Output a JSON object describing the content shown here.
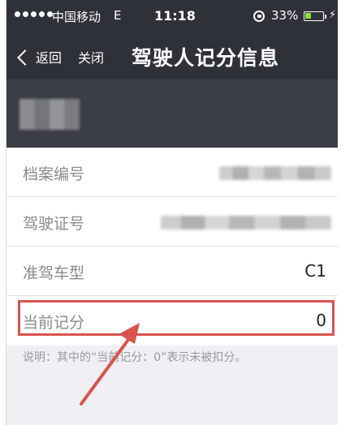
{
  "status_bar": {
    "carrier": "中国移动",
    "network": "E",
    "time": "11:18",
    "battery_percent": "33%",
    "battery_level": 0.33
  },
  "nav": {
    "back_label": "返回",
    "close_label": "关闭",
    "title": "驾驶人记分信息"
  },
  "rows": [
    {
      "label": "档案编号",
      "value": "",
      "redacted": true
    },
    {
      "label": "驾驶证号",
      "value": "",
      "redacted": true
    },
    {
      "label": "准驾车型",
      "value": "C1",
      "redacted": false
    },
    {
      "label": "当前记分",
      "value": "0",
      "redacted": false
    }
  ],
  "note": "说明：其中的“当前记分：0”表示未被扣分。",
  "colors": {
    "bar": "#2e3138",
    "highlight": "#d9534f",
    "battery": "#8ae042"
  }
}
